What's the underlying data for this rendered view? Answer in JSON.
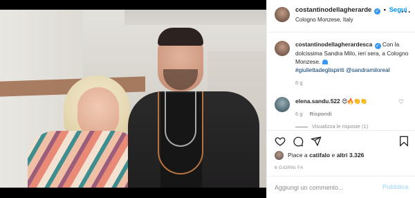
{
  "header": {
    "username": "costantinodellagherarde",
    "follow_label": "Segui",
    "location": "Cologno Monzese, Italy",
    "more_icon": "more-horizontal-icon"
  },
  "caption": {
    "username": "costantinodellagherardesca",
    "text": "Con la dolcissima Sandra Milo, ieri sera, a Cologno Monzese.",
    "emoji": "blue-heart",
    "hashtags": "#giuliettadeglispiriti @sandramiloreal",
    "time": "6 g"
  },
  "comments": [
    {
      "username": "elena.sandu.522",
      "text": "😍🔥👏👏",
      "time": "6 g",
      "reply_label": "Rispondi",
      "view_replies": "Visualizza le risposte (1)"
    }
  ],
  "actions": {
    "like_icon": "heart-icon",
    "comment_icon": "comment-icon",
    "share_icon": "send-icon",
    "save_icon": "bookmark-icon"
  },
  "likes": {
    "prefix": "Piace a ",
    "user": "catifalo",
    "middle": " e ",
    "others": "altri 3.326"
  },
  "date": "6 GIORNI FA",
  "add_comment": {
    "placeholder": "Aggiungi un commento...",
    "publish_label": "Pubblica"
  },
  "colors": {
    "accent": "#0095f6",
    "publish_disabled": "#b2dffc",
    "muted": "#8e8e8e",
    "text": "#262626"
  }
}
